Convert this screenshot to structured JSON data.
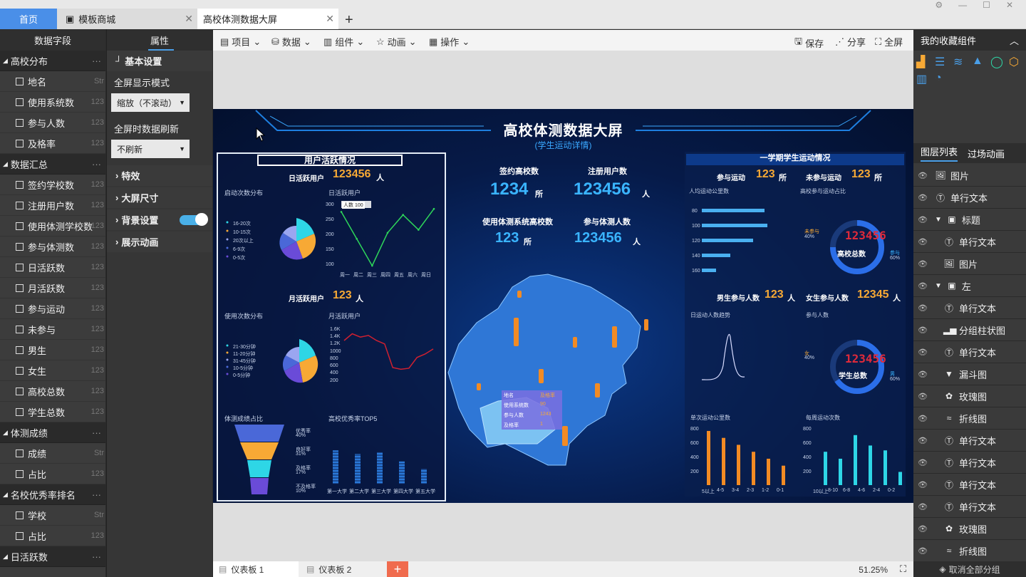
{
  "tabs": {
    "home": "首页",
    "template": "模板商城",
    "screen": "高校体测数据大屏"
  },
  "left_panel": {
    "title": "数据字段",
    "groups": [
      {
        "label": "高校分布",
        "items": [
          {
            "label": "地名",
            "type": "Str"
          },
          {
            "label": "使用系统数",
            "type": "123"
          },
          {
            "label": "参与人数",
            "type": "123"
          },
          {
            "label": "及格率",
            "type": "123"
          }
        ]
      },
      {
        "label": "数据汇总",
        "items": [
          {
            "label": "签约学校数",
            "type": "123"
          },
          {
            "label": "注册用户数",
            "type": "123"
          },
          {
            "label": "使用体测学校数",
            "type": "123"
          },
          {
            "label": "参与体测数",
            "type": "123"
          },
          {
            "label": "日活跃数",
            "type": "123"
          },
          {
            "label": "月活跃数",
            "type": "123"
          },
          {
            "label": "参与运动",
            "type": "123"
          },
          {
            "label": "未参与",
            "type": "123"
          },
          {
            "label": "男生",
            "type": "123"
          },
          {
            "label": "女生",
            "type": "123"
          },
          {
            "label": "高校总数",
            "type": "123"
          },
          {
            "label": "学生总数",
            "type": "123"
          }
        ]
      },
      {
        "label": "体测成绩",
        "items": [
          {
            "label": "成绩",
            "type": "Str"
          },
          {
            "label": "占比",
            "type": "123"
          }
        ]
      },
      {
        "label": "名校优秀率排名",
        "items": [
          {
            "label": "学校",
            "type": "Str"
          },
          {
            "label": "占比",
            "type": "123"
          }
        ]
      },
      {
        "label": "日活跃数",
        "items": []
      }
    ]
  },
  "prop_panel": {
    "title": "属性",
    "basic": "基本设置",
    "fullscreen_mode_label": "全屏显示模式",
    "fullscreen_mode_value": "缩放（不滚动）",
    "refresh_label": "全屏时数据刷新",
    "refresh_value": "不刷新",
    "sections": [
      "特效",
      "大屏尺寸",
      "背景设置",
      "展示动画"
    ]
  },
  "toolbar": {
    "project": "项目",
    "data": "数据",
    "component": "组件",
    "animation": "动画",
    "operation": "操作",
    "save": "保存",
    "share": "分享",
    "fullscreen": "全屏"
  },
  "right_panel": {
    "favorites_title": "我的收藏组件",
    "layer_tab": "图层列表",
    "transition_tab": "过场动画",
    "layers": [
      {
        "label": "图片",
        "icon": "image-icon",
        "indent": 0
      },
      {
        "label": "单行文本",
        "icon": "text-icon",
        "indent": 0
      },
      {
        "label": "标题",
        "icon": "group-icon",
        "indent": 1,
        "group": true
      },
      {
        "label": "单行文本",
        "icon": "text-icon",
        "indent": 2
      },
      {
        "label": "图片",
        "icon": "image-icon",
        "indent": 2
      },
      {
        "label": "左",
        "icon": "group-icon",
        "indent": 1,
        "group": true
      },
      {
        "label": "单行文本",
        "icon": "text-icon",
        "indent": 2
      },
      {
        "label": "分组柱状图",
        "icon": "bar-chart-icon",
        "indent": 2
      },
      {
        "label": "单行文本",
        "icon": "text-icon",
        "indent": 2
      },
      {
        "label": "漏斗图",
        "icon": "funnel-icon",
        "indent": 2
      },
      {
        "label": "玫瑰图",
        "icon": "rose-icon",
        "indent": 2
      },
      {
        "label": "折线图",
        "icon": "line-icon",
        "indent": 2
      },
      {
        "label": "单行文本",
        "icon": "text-icon",
        "indent": 2
      },
      {
        "label": "单行文本",
        "icon": "text-icon",
        "indent": 2
      },
      {
        "label": "单行文本",
        "icon": "text-icon",
        "indent": 2
      },
      {
        "label": "单行文本",
        "icon": "text-icon",
        "indent": 2
      },
      {
        "label": "玫瑰图",
        "icon": "rose-icon",
        "indent": 2
      },
      {
        "label": "折线图",
        "icon": "line-icon",
        "indent": 2
      }
    ],
    "footer": "取消全部分组"
  },
  "bottom": {
    "dash1": "仪表板 1",
    "dash2": "仪表板 2",
    "zoom": "51.25%"
  },
  "screen": {
    "title": "高校体测数据大屏",
    "subtitle": "(学生运动详情)",
    "left_title": "用户活跃情况",
    "daily_label": "日活跃用户",
    "daily_value": "123456",
    "unit_person": "人",
    "unit_school": "所",
    "start_dist": "启动次数分布",
    "daily_chart": "日活跃用户",
    "monthly_label": "月活跃用户",
    "monthly_value": "123",
    "use_dist": "使用次数分布",
    "monthly_chart": "月活跃用户",
    "pass_ratio": "体测成绩占比",
    "top5": "高校优秀率TOP5",
    "signed_label": "签约高校数",
    "signed_value": "1234",
    "registered_label": "注册用户数",
    "registered_value": "123456",
    "using_label": "使用体测系统高校数",
    "using_value": "123",
    "participants_label": "参与体测人数",
    "participants_value": "123456",
    "right_title": "一学期学生运动情况",
    "sport_label": "参与运动",
    "sport_value": "123",
    "nosport_label": "未参与运动",
    "nosport_value": "123",
    "avg_km": "人均运动公里数",
    "ratio_label": "高校参与运动占比",
    "total_school_label": "高校总数",
    "total_school_value": "123456",
    "male_label": "男生参与人数",
    "male_value": "123",
    "female_label": "女生参与人数",
    "female_value": "12345",
    "daily_trend": "日运动人数趋势",
    "join_count": "参与人数",
    "total_student_label": "学生总数",
    "total_student_value": "123456",
    "single_km": "单次运动公里数",
    "weekly_count": "每周运动次数",
    "tooltip": {
      "name": "地名",
      "rate": "及格率",
      "r1": "使用系统数",
      "v1": "90",
      "r2": "参与人数",
      "v2": "1243",
      "r3": "及格率",
      "v3": "1"
    },
    "tip_person": "人数",
    "tip_value": "100",
    "legend_start": [
      "16-20次",
      "10-15次",
      "20次以上",
      "6-9次",
      "0-5次"
    ],
    "legend_use": [
      "21-30分钟",
      "11-20分钟",
      "31-45分钟",
      "10-5分钟",
      "0-5分钟"
    ],
    "funnel_labels": [
      "优秀率",
      "良好率",
      "及格率",
      "不及格率"
    ],
    "funnel_values": [
      "40%",
      "31%",
      "17%",
      "10%"
    ],
    "top5_schools": [
      "第一大学",
      "第二大学",
      "第三大学",
      "第四大学",
      "第五大学"
    ],
    "week_days": [
      "周一",
      "周二",
      "周三",
      "周四",
      "周五",
      "周六",
      "周日"
    ],
    "donut1_left": "未参与",
    "donut1_left_pct": "40%",
    "donut1_right": "参与",
    "donut1_right_pct": "60%",
    "donut2_left": "女",
    "donut2_left_pct": "40%",
    "donut2_right": "男",
    "donut2_right_pct": "60%",
    "km_bars_y": [
      "80",
      "100",
      "120",
      "140",
      "160"
    ],
    "km_bars_x": [
      "0",
      "500",
      "1000",
      "1.5K",
      "2K",
      "2.5K",
      "3K"
    ],
    "single_x": [
      "5以上",
      "4-5",
      "3-4",
      "2-3",
      "1-2",
      "0-1"
    ],
    "weekly_x": [
      "10以上",
      "8-10",
      "6-8",
      "4-6",
      "2-4",
      "0-2"
    ]
  },
  "chart_data": [
    {
      "type": "line",
      "title": "日活跃用户",
      "categories": [
        "周一",
        "周二",
        "周三",
        "周四",
        "周五",
        "周六",
        "周日"
      ],
      "values": [
        280,
        190,
        100,
        210,
        270,
        220,
        290
      ],
      "ylim": [
        100,
        300
      ]
    },
    {
      "type": "line",
      "title": "月活跃用户",
      "values": [
        1200,
        1400,
        1300,
        1350,
        1200,
        1100,
        400,
        350,
        380,
        700,
        800,
        950
      ],
      "ylim": [
        0,
        1600
      ]
    },
    {
      "type": "bar",
      "title": "人均运动公里数",
      "categories": [
        "80",
        "100",
        "120",
        "140",
        "160"
      ],
      "values": [
        2200,
        2300,
        1800,
        1000,
        500
      ]
    },
    {
      "type": "bar",
      "title": "单次运动公里数",
      "categories": [
        "5以上",
        "4-5",
        "3-4",
        "2-3",
        "1-2",
        "0-1"
      ],
      "values": [
        780,
        680,
        580,
        480,
        380,
        280
      ],
      "ylim": [
        0,
        800
      ]
    },
    {
      "type": "bar",
      "title": "每周运动次数",
      "categories": [
        "10以上",
        "8-10",
        "6-8",
        "4-6",
        "2-4",
        "0-2"
      ],
      "values": [
        480,
        380,
        720,
        570,
        500,
        190
      ],
      "ylim": [
        0,
        800
      ]
    },
    {
      "type": "bar",
      "title": "高校优秀率TOP5",
      "categories": [
        "第一大学",
        "第二大学",
        "第三大学",
        "第四大学",
        "第五大学"
      ],
      "values": [
        90,
        80,
        85,
        60,
        40
      ]
    }
  ],
  "colors": {
    "accent": "#4a8fe8",
    "gold": "#f7a935",
    "cyan": "#3ab4ff",
    "orange": "#f28b24",
    "teal": "#2ed6e6"
  }
}
